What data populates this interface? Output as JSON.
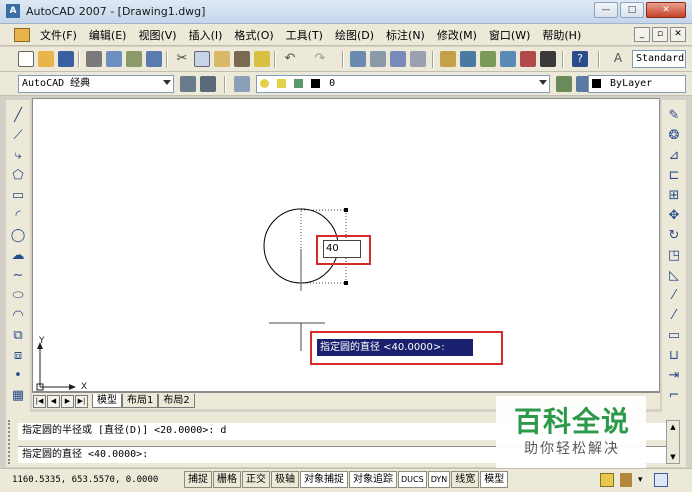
{
  "window": {
    "title": "AutoCAD 2007 - [Drawing1.dwg]",
    "app_icon": "A"
  },
  "menu": [
    "文件(F)",
    "编辑(E)",
    "视图(V)",
    "插入(I)",
    "格式(O)",
    "工具(T)",
    "绘图(D)",
    "标注(N)",
    "修改(M)",
    "窗口(W)",
    "帮助(H)"
  ],
  "toolbar": {
    "text_style": "Standard",
    "workspace": "AutoCAD 经典",
    "layer": "0",
    "color": "ByLayer"
  },
  "drawing": {
    "input_value": "40",
    "tooltip": "指定圆的直径 <40.0000>:",
    "ucs_x": "X",
    "ucs_y": "Y"
  },
  "tabs": [
    "模型",
    "布局1",
    "布局2"
  ],
  "command": {
    "line1": "指定圆的半径或 [直径(D)] <20.0000>: d",
    "line2": "指定圆的直径 <40.0000>:"
  },
  "status": {
    "coords": "1160.5335, 653.5570, 0.0000",
    "buttons": [
      "捕捉",
      "栅格",
      "正交",
      "极轴",
      "对象捕捉",
      "对象追踪",
      "DUCS",
      "DYN",
      "线宽",
      "模型"
    ]
  },
  "watermark": {
    "main": "百科全说",
    "sub": "助你轻松解决"
  },
  "colors": {
    "highlight": "#d62a2a",
    "tooltip_bg": "#1a1f6e",
    "watermark_green": "#2c9a4a"
  }
}
